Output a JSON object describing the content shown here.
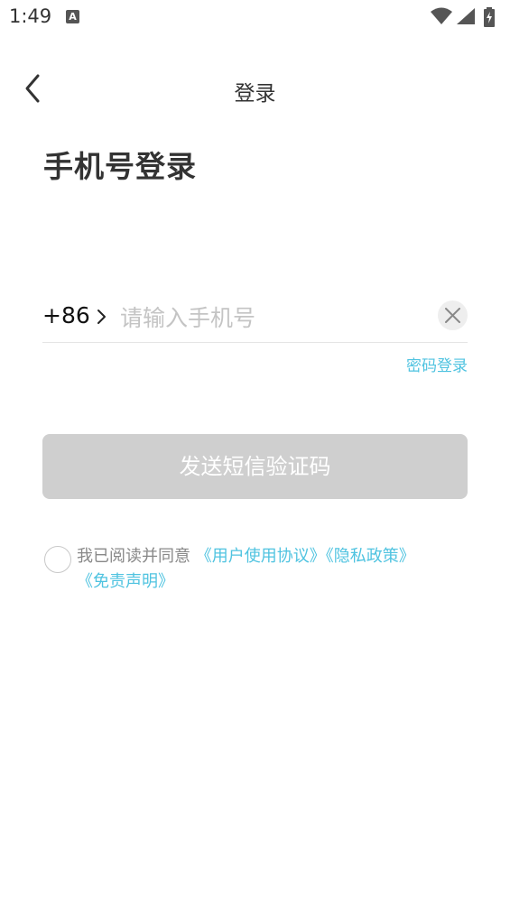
{
  "status_bar": {
    "time": "1:49",
    "notification_icon": "font-a-icon",
    "icons": [
      "wifi-icon",
      "signal-icon",
      "battery-charging-icon"
    ]
  },
  "nav": {
    "back_icon": "chevron-left-icon",
    "title": "登录"
  },
  "page_title": "手机号登录",
  "phone": {
    "country_code": "+86",
    "chevron_icon": "chevron-right-icon",
    "placeholder": "请输入手机号",
    "value": "",
    "clear_icon": "close-icon"
  },
  "password_login_label": "密码登录",
  "send_code_label": "发送短信验证码",
  "agreement": {
    "checked": false,
    "prefix": "我已阅读并同意",
    "user_agreement": "《用户使用协议》",
    "privacy_policy": "《隐私政策》",
    "disclaimer": "《免责声明》"
  },
  "colors": {
    "link": "#4fc3e0",
    "button_disabled": "#cfcfcf",
    "placeholder": "#c4c4c4"
  }
}
